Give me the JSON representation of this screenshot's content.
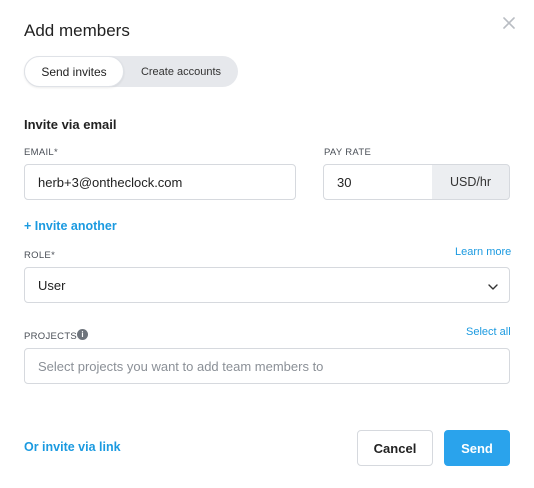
{
  "modal": {
    "title": "Add members"
  },
  "tabs": {
    "send_invites": "Send invites",
    "create_accounts": "Create accounts"
  },
  "invite": {
    "section_title": "Invite via email",
    "email_label": "EMAIL*",
    "email_value": "herb+3@ontheclock.com",
    "pay_rate_label": "PAY RATE",
    "pay_rate_value": "30",
    "pay_rate_unit": "USD/hr",
    "invite_another": "+ Invite another"
  },
  "role": {
    "label": "ROLE*",
    "learn_more": "Learn more",
    "value": "User"
  },
  "projects": {
    "label": "PROJECTS",
    "select_all": "Select all",
    "placeholder": "Select projects you want to add team members to"
  },
  "footer": {
    "invite_link": "Or invite via link",
    "cancel": "Cancel",
    "send": "Send"
  },
  "colors": {
    "accent": "#2aa3ec",
    "link": "#1b9ae0"
  },
  "icons": {
    "close": "close-icon",
    "dropdown": "chevron-down-icon",
    "info": "info-icon"
  }
}
